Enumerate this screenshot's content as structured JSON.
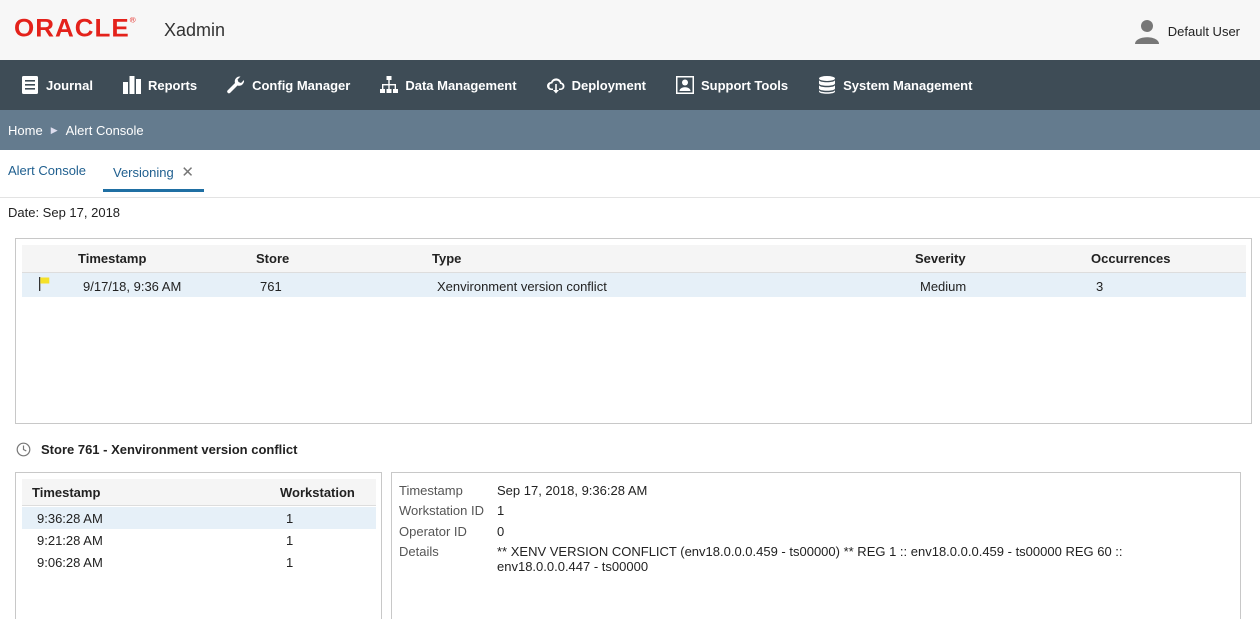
{
  "header": {
    "logo": "ORACLE",
    "logo_mark": "®",
    "app_name": "Xadmin",
    "user_name": "Default User"
  },
  "nav": [
    {
      "label": "Journal",
      "icon": "journal-icon"
    },
    {
      "label": "Reports",
      "icon": "reports-icon"
    },
    {
      "label": "Config Manager",
      "icon": "wrench-icon"
    },
    {
      "label": "Data Management",
      "icon": "hierarchy-icon"
    },
    {
      "label": "Deployment",
      "icon": "cloud-download-icon"
    },
    {
      "label": "Support Tools",
      "icon": "support-icon"
    },
    {
      "label": "System Management",
      "icon": "database-icon"
    }
  ],
  "breadcrumb": {
    "home": "Home",
    "current": "Alert Console"
  },
  "tabs": [
    {
      "label": "Alert Console",
      "active": false
    },
    {
      "label": "Versioning",
      "active": true,
      "close": "✕"
    }
  ],
  "date_label": "Date: Sep 17, 2018",
  "alerts": {
    "columns": [
      "Timestamp",
      "Store",
      "Type",
      "Severity",
      "Occurrences"
    ],
    "rows": [
      {
        "timestamp": "9/17/18, 9:36 AM",
        "store": "761",
        "type": "Xenvironment version conflict",
        "severity": "Medium",
        "occurrences": "3",
        "flag_color": "#f5e12a"
      }
    ]
  },
  "detail_title": "Store 761 - Xenvironment version conflict",
  "occurrences": {
    "columns": [
      "Timestamp",
      "Workstation"
    ],
    "rows": [
      {
        "timestamp": "9:36:28 AM",
        "workstation": "1"
      },
      {
        "timestamp": "9:21:28 AM",
        "workstation": "1"
      },
      {
        "timestamp": "9:06:28 AM",
        "workstation": "1"
      }
    ]
  },
  "details": {
    "timestamp_label": "Timestamp",
    "timestamp_value": "Sep 17, 2018, 9:36:28 AM",
    "workstation_label": "Workstation ID",
    "workstation_value": "1",
    "operator_label": "Operator ID",
    "operator_value": "0",
    "details_label": "Details",
    "details_line1": "** XENV VERSION CONFLICT (env18.0.0.0.459 - ts00000) ** REG 1 :: env18.0.0.0.459 - ts00000 REG 60 ::",
    "details_line2": "env18.0.0.0.447 - ts00000"
  },
  "colors": {
    "nav_bg": "#3e4c56",
    "breadcrumb_bg": "#647b8e",
    "logo_red": "#e4221b",
    "selected_row": "#e6f0f8",
    "tab_accent": "#1f6fa3"
  }
}
